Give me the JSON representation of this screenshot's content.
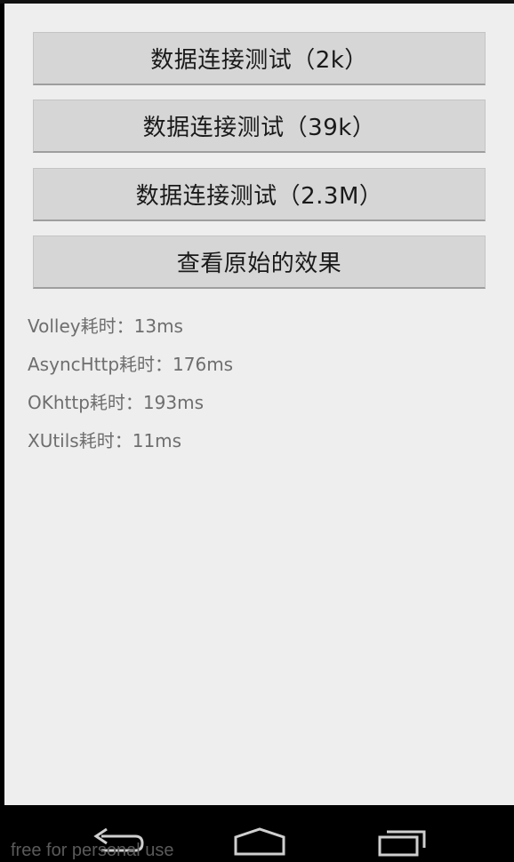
{
  "buttons": [
    {
      "label": "数据连接测试（2k）"
    },
    {
      "label": "数据连接测试（39k）"
    },
    {
      "label": "数据连接测试（2.3M）"
    },
    {
      "label": "查看原始的效果"
    }
  ],
  "results": [
    {
      "text": "Volley耗时：13ms"
    },
    {
      "text": "AsyncHttp耗时：176ms"
    },
    {
      "text": "OKhttp耗时：193ms"
    },
    {
      "text": "XUtils耗时：11ms"
    }
  ],
  "navigation": {
    "back_icon": "back-arrow-icon",
    "home_icon": "home-icon",
    "recents_icon": "recent-apps-icon"
  },
  "watermark": "free for personal use"
}
